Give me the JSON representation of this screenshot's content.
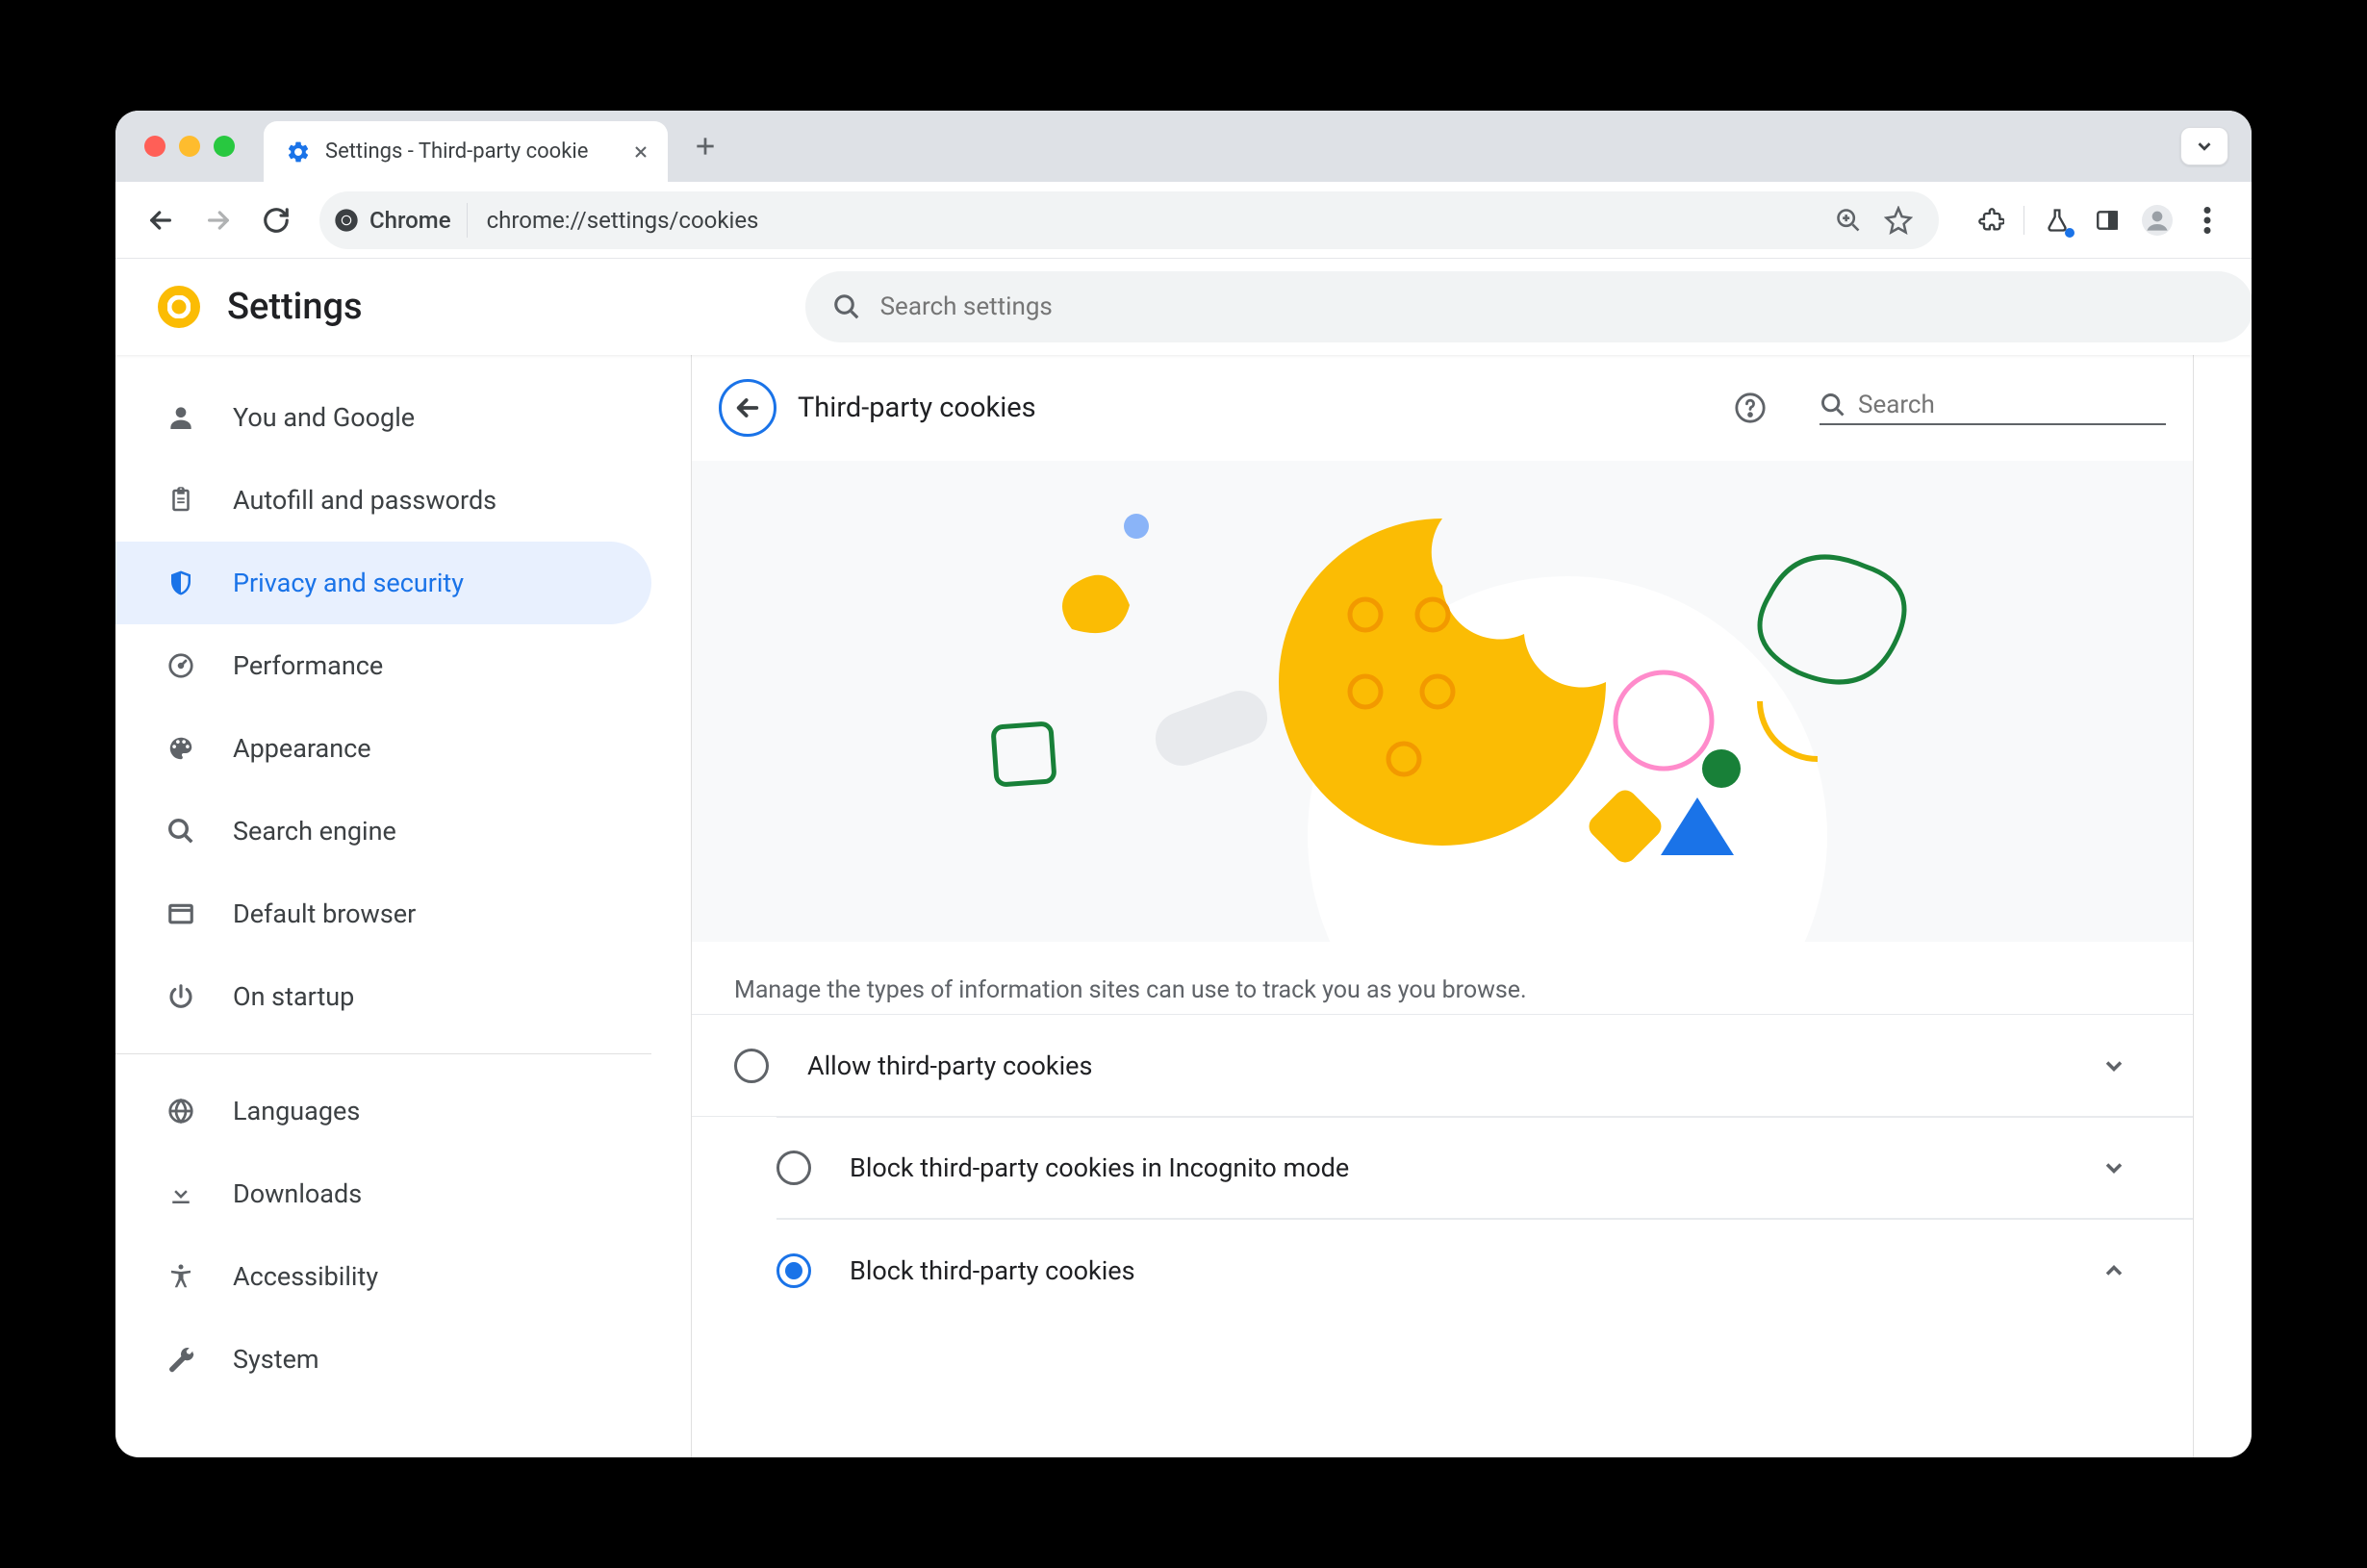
{
  "window": {
    "tab_title": "Settings - Third-party cookie",
    "url": "chrome://settings/cookies",
    "omnibox_chip": "Chrome"
  },
  "header": {
    "title": "Settings",
    "search_placeholder": "Search settings"
  },
  "sidebar": {
    "items": [
      {
        "label": "You and Google",
        "icon": "person"
      },
      {
        "label": "Autofill and passwords",
        "icon": "clipboard"
      },
      {
        "label": "Privacy and security",
        "icon": "shield",
        "active": true
      },
      {
        "label": "Performance",
        "icon": "speed"
      },
      {
        "label": "Appearance",
        "icon": "palette"
      },
      {
        "label": "Search engine",
        "icon": "search"
      },
      {
        "label": "Default browser",
        "icon": "browser"
      },
      {
        "label": "On startup",
        "icon": "power"
      }
    ],
    "items2": [
      {
        "label": "Languages",
        "icon": "globe"
      },
      {
        "label": "Downloads",
        "icon": "download"
      },
      {
        "label": "Accessibility",
        "icon": "accessibility"
      },
      {
        "label": "System",
        "icon": "wrench"
      }
    ]
  },
  "content": {
    "title": "Third-party cookies",
    "search_placeholder": "Search",
    "description": "Manage the types of information sites can use to track you as you browse.",
    "options": [
      {
        "label": "Allow third-party cookies",
        "selected": false,
        "expanded": false
      },
      {
        "label": "Block third-party cookies in Incognito mode",
        "selected": false,
        "expanded": false
      },
      {
        "label": "Block third-party cookies",
        "selected": true,
        "expanded": true
      }
    ]
  },
  "colors": {
    "accent": "#1a73e8",
    "yellow": "#fbbc04",
    "green": "#188038",
    "pink": "#ff8bcb"
  }
}
